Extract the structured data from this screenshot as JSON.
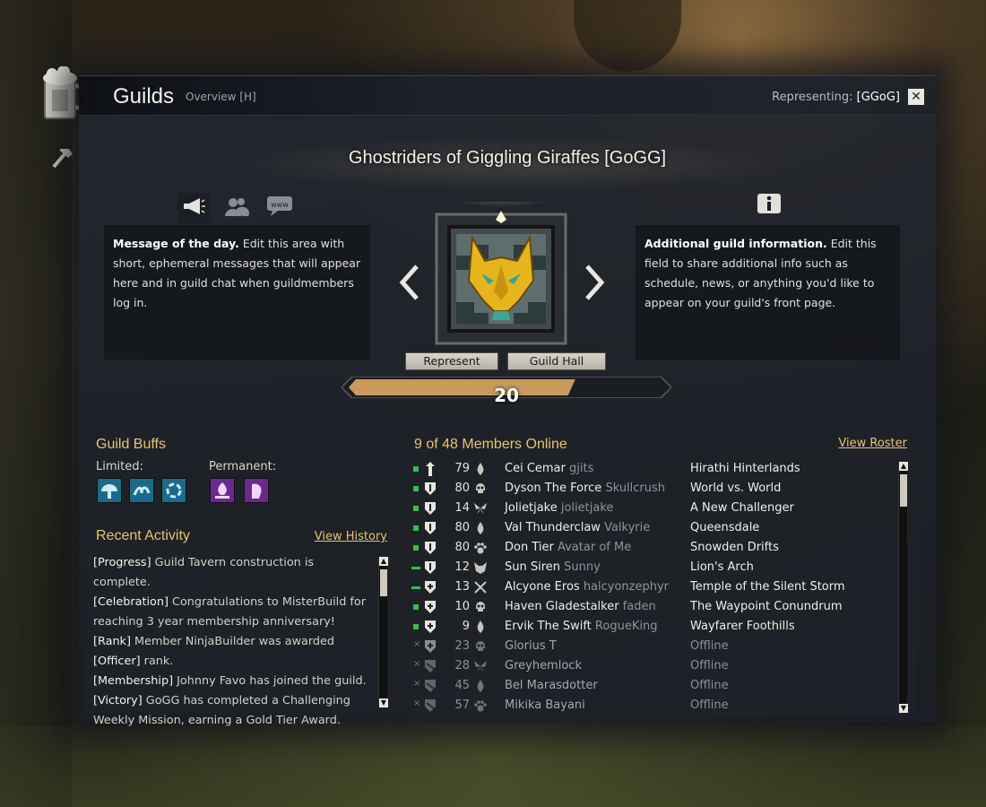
{
  "window": {
    "title": "Guilds",
    "subtitle": "Overview [H]",
    "representing_label": "Representing:",
    "representing_tag": "[GGoG]",
    "close_label": "✕"
  },
  "guild": {
    "name": "Ghostriders of Giggling Giraffes [GoGG]",
    "level": "20",
    "level_progress": 0.72
  },
  "motd": {
    "bold": "Message of the day.",
    "text": " Edit this area with short, ephemeral messages that will appear here and in guild chat when guildmembers log in."
  },
  "additional_info": {
    "bold": "Additional guild information.",
    "text": " Edit this field to share additional info such as schedule, news, or anything you'd like to appear on your guild's front page."
  },
  "buttons": {
    "represent": "Represent",
    "guild_hall": "Guild Hall"
  },
  "buffs": {
    "title": "Guild Buffs",
    "limited_label": "Limited:",
    "permanent_label": "Permanent:"
  },
  "activity": {
    "title": "Recent Activity",
    "link": "View History",
    "entries": [
      {
        "tag": "[Progress]",
        "text": " Guild Tavern construction is complete."
      },
      {
        "tag": "[Celebration]",
        "text": " Congratulations to MisterBuild for reaching 3 year membership anniversary!"
      },
      {
        "tag": "[Rank]",
        "text": " Member NinjaBuilder was awarded ",
        "tag2": "[Officer]",
        "text2": " rank."
      },
      {
        "tag": "[Membership]",
        "text": "  Johnny Favo has joined the guild."
      },
      {
        "tag": "[Victory]",
        "text": " GoGG has completed a Challenging Weekly Mission, earning a Gold Tier Award."
      }
    ]
  },
  "members": {
    "title": "9 of 48 Members Online",
    "link": "View Roster",
    "rows": [
      {
        "status": "online",
        "rank": "leader",
        "level": "79",
        "prof": "drop",
        "name": "Cei Cemar",
        "acct": "gjits",
        "loc": "Hirathi Hinterlands"
      },
      {
        "status": "online",
        "rank": "officer",
        "level": "80",
        "prof": "skull",
        "name": "Dyson The Force",
        "acct": "Skullcrush",
        "loc": "World vs. World"
      },
      {
        "status": "online",
        "rank": "officer",
        "level": "14",
        "prof": "butterfly",
        "name": "Jolietjake",
        "acct": "jolietjake",
        "loc": "A New Challenger"
      },
      {
        "status": "online",
        "rank": "officer",
        "level": "80",
        "prof": "drop",
        "name": "Val Thunderclaw",
        "acct": "Valkyrie",
        "loc": "Queensdale"
      },
      {
        "status": "online",
        "rank": "officer",
        "level": "80",
        "prof": "paw",
        "name": "Don Tier",
        "acct": "Avatar of Me",
        "loc": "Snowden Drifts"
      },
      {
        "status": "away",
        "rank": "officer",
        "level": "12",
        "prof": "mask",
        "name": "Sun Siren",
        "acct": "Sunny",
        "loc": "Lion's Arch"
      },
      {
        "status": "away",
        "rank": "member",
        "level": "13",
        "prof": "swords",
        "name": "Alcyone Eros",
        "acct": "halcyonzephyr",
        "loc": "Temple of the Silent Storm"
      },
      {
        "status": "online",
        "rank": "member",
        "level": "10",
        "prof": "skull",
        "name": "Haven Gladestalker",
        "acct": "faden",
        "loc": "The Waypoint Conundrum"
      },
      {
        "status": "online",
        "rank": "member",
        "level": "9",
        "prof": "drop",
        "name": "Ervik The Swift",
        "acct": "RogueKing",
        "loc": "Wayfarer Foothills"
      },
      {
        "status": "offline",
        "rank": "member",
        "level": "23",
        "prof": "skull",
        "name": "Glorius T",
        "acct": "",
        "loc": "Offline"
      },
      {
        "status": "offline",
        "rank": "recruit",
        "level": "28",
        "prof": "butterfly",
        "name": "Greyhemlock",
        "acct": "",
        "loc": "Offline"
      },
      {
        "status": "offline",
        "rank": "recruit",
        "level": "45",
        "prof": "drop",
        "name": "Bel Marasdotter",
        "acct": "",
        "loc": "Offline"
      },
      {
        "status": "offline",
        "rank": "recruit",
        "level": "57",
        "prof": "paw",
        "name": "Mikika Bayani",
        "acct": "",
        "loc": "Offline"
      }
    ]
  },
  "colors": {
    "accent": "#e8c270",
    "online": "#2ec24a"
  }
}
